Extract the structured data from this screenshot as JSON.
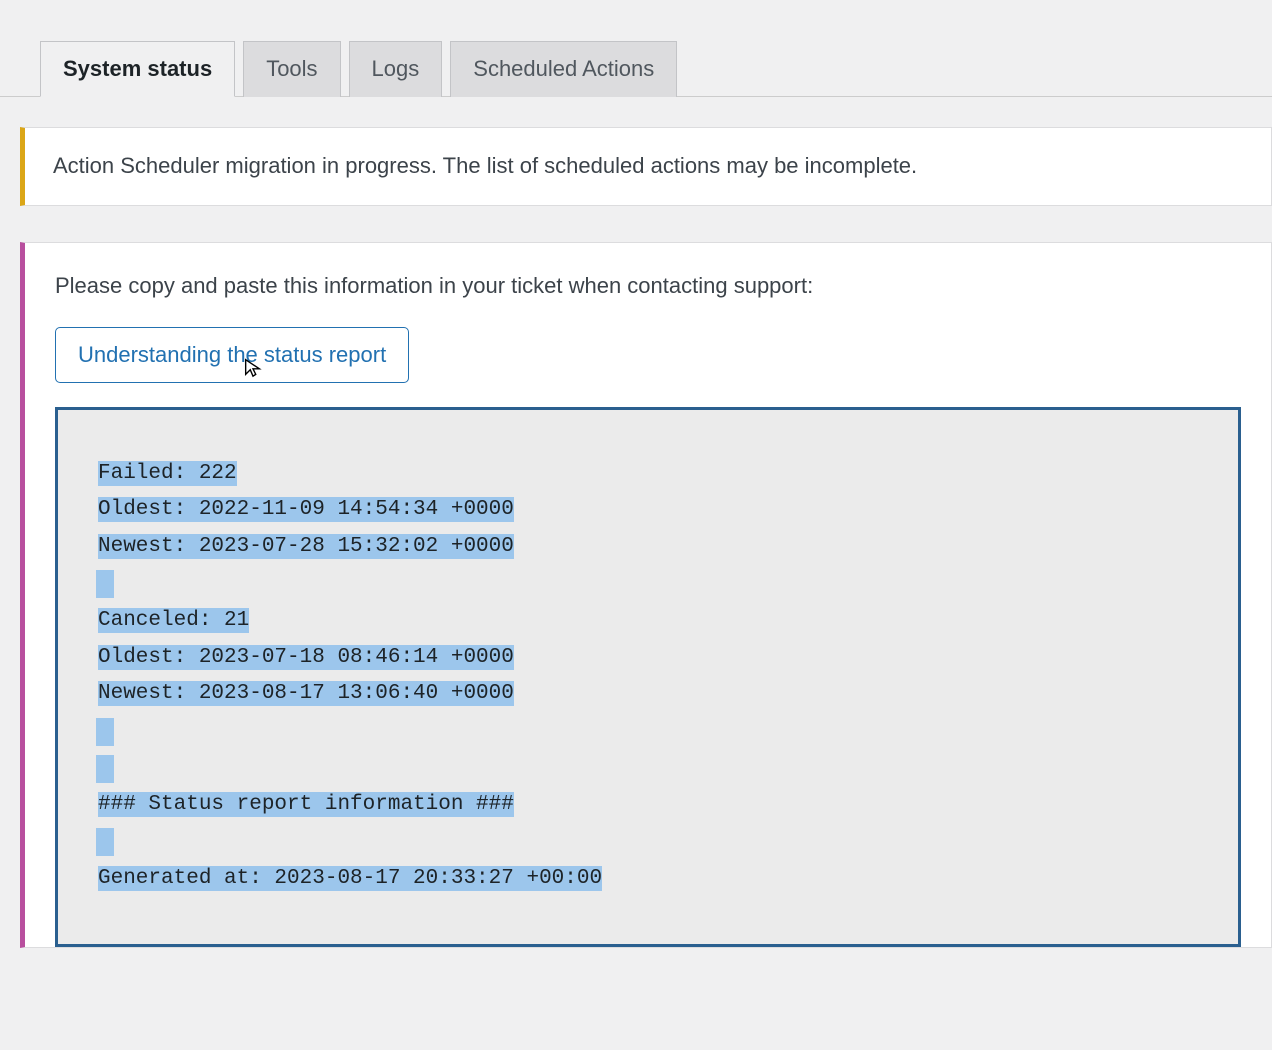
{
  "tabs": {
    "system_status": "System status",
    "tools": "Tools",
    "logs": "Logs",
    "scheduled_actions": "Scheduled Actions"
  },
  "notice": {
    "text": "Action Scheduler migration in progress. The list of scheduled actions may be incomplete."
  },
  "panel": {
    "intro": "Please copy and paste this information in your ticket when contacting support:",
    "button_label": "Understanding the status report"
  },
  "report": {
    "failed_label": "Failed: 222",
    "failed_oldest": "Oldest: 2022-11-09 14:54:34 +0000",
    "failed_newest": "Newest: 2023-07-28 15:32:02 +0000",
    "canceled_label": "Canceled: 21",
    "canceled_oldest": "Oldest: 2023-07-18 08:46:14 +0000",
    "canceled_newest": "Newest: 2023-08-17 13:06:40 +0000",
    "section_header": "### Status report information ###",
    "generated_at": "Generated at: 2023-08-17 20:33:27 +00:00"
  }
}
